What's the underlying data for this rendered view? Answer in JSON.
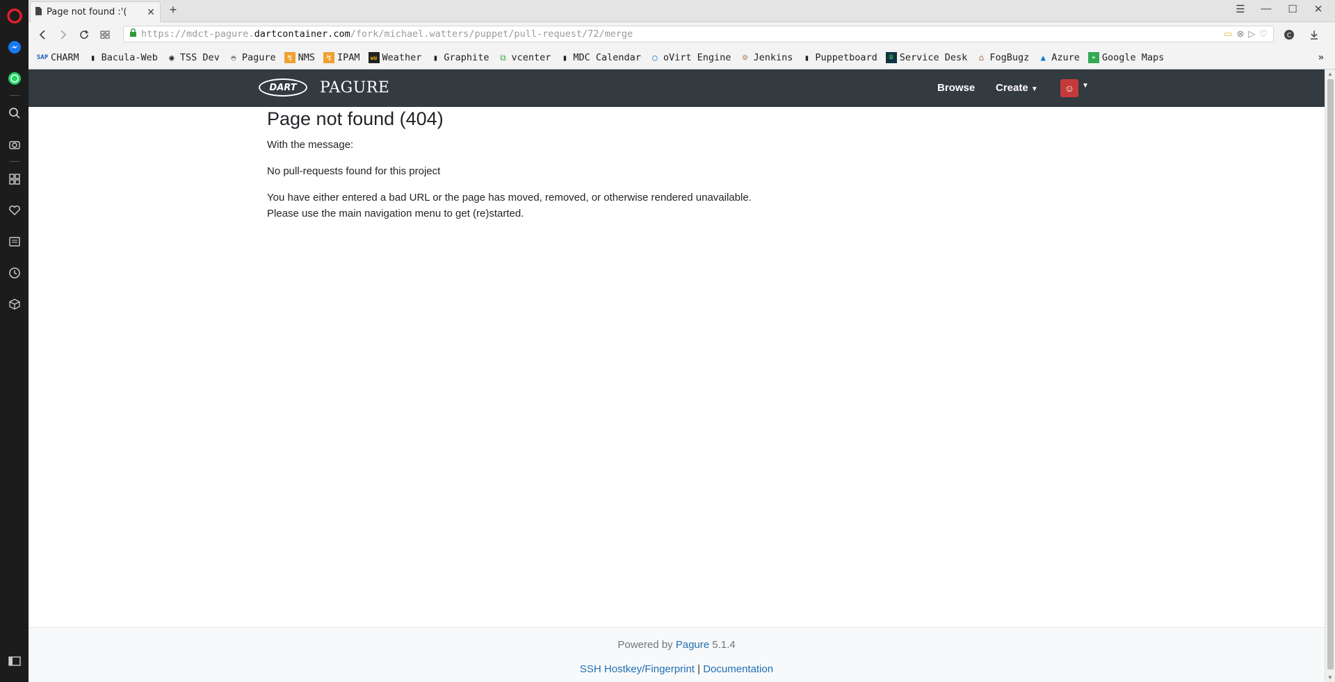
{
  "browser": {
    "tab_title": "Page not found :'(",
    "url_prefix": "https://mdct-pagure.",
    "url_domain": "dartcontainer.com",
    "url_path": "/fork/michael.watters/puppet/pull-request/72/merge"
  },
  "bookmarks": [
    {
      "label": "CHARM",
      "icon": "sap-icon"
    },
    {
      "label": "Bacula-Web",
      "icon": "page-icon"
    },
    {
      "label": "TSS Dev",
      "icon": "circle-icon"
    },
    {
      "label": "Pagure",
      "icon": "pagure-icon"
    },
    {
      "label": "NMS",
      "icon": "nms-icon"
    },
    {
      "label": "IPAM",
      "icon": "ipam-icon"
    },
    {
      "label": "Weather",
      "icon": "weather-icon"
    },
    {
      "label": "Graphite",
      "icon": "page-icon"
    },
    {
      "label": "vcenter",
      "icon": "vcenter-icon"
    },
    {
      "label": "MDC Calendar",
      "icon": "page-icon"
    },
    {
      "label": "oVirt Engine",
      "icon": "ovirt-icon"
    },
    {
      "label": "Jenkins",
      "icon": "jenkins-icon"
    },
    {
      "label": "Puppetboard",
      "icon": "page-icon"
    },
    {
      "label": "Service Desk",
      "icon": "servicedesk-icon"
    },
    {
      "label": "FogBugz",
      "icon": "fogbugz-icon"
    },
    {
      "label": "Azure",
      "icon": "azure-icon"
    },
    {
      "label": "Google Maps",
      "icon": "maps-icon"
    }
  ],
  "navbar": {
    "logo_text": "DART",
    "brand": "PAGURE",
    "browse": "Browse",
    "create": "Create"
  },
  "content": {
    "heading": "Page not found (404)",
    "intro": "With the message:",
    "message": "No pull-requests found for this project",
    "explanation_line1": "You have either entered a bad URL or the page has moved, removed, or otherwise rendered unavailable.",
    "explanation_line2": "Please use the main navigation menu to get (re)started."
  },
  "footer": {
    "powered_by": "Powered by",
    "pagure_link": "Pagure",
    "version": "5.1.4",
    "ssh_link": "SSH Hostkey/Fingerprint",
    "separator": "|",
    "docs_link": "Documentation"
  },
  "colors": {
    "navbar_bg": "#333a40",
    "link": "#1f6fb5",
    "sidebar_bg": "#1c1c1c"
  }
}
